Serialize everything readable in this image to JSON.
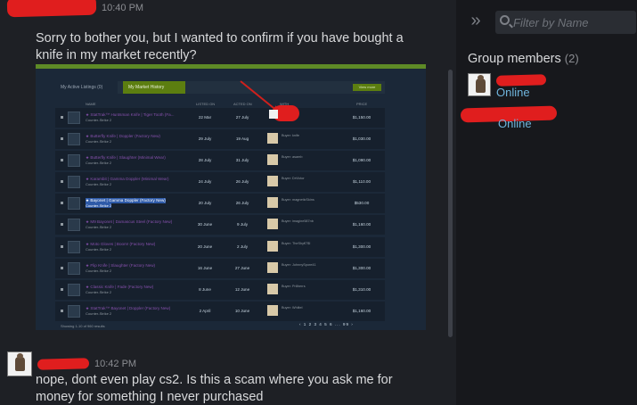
{
  "messages": [
    {
      "time": "10:40 PM",
      "text_lines": [
        "Sorry to bother you, but I wanted to confirm if you have bought a",
        "knife in my market recently?"
      ]
    },
    {
      "time": "10:42 PM",
      "text_lines": [
        "nope, dont even play cs2. Is this a scam where you ask me for",
        "money for something I never purchased"
      ]
    }
  ],
  "screenshot": {
    "tabs": [
      "My Active Listings (0)",
      "My Market History"
    ],
    "columns": [
      "NAME",
      "LISTED ON",
      "ACTED ON",
      "WITH",
      "PRICE"
    ],
    "rows": [
      {
        "name": "★ StatTrak™ Huntsman Knife | Tiger Tooth (Fa...",
        "game": "Counter-Strike 2",
        "listed": "22 Mar",
        "acted": "27 July",
        "buyer": "",
        "price": "$1,150.00"
      },
      {
        "name": "★ Butterfly Knife | Doppler (Factory New)",
        "game": "Counter-Strike 2",
        "listed": "29 July",
        "acted": "19 Aug",
        "buyer": "Buyer: knife",
        "price": "$1,030.00"
      },
      {
        "name": "★ Butterfly Knife | Slaughter (Minimal Wear)",
        "game": "Counter-Strike 2",
        "listed": "28 July",
        "acted": "31 July",
        "buyer": "Buyer: asamb",
        "price": "$1,090.00"
      },
      {
        "name": "★ Karambit | Gamma Doppler (Minimal Wear)",
        "game": "Counter-Strike 2",
        "listed": "24 July",
        "acted": "26 July",
        "buyer": "Buyer: DrVictor",
        "price": "$1,110.00"
      },
      {
        "name": "★ Bayonet | Gamma Doppler (Factory New)",
        "game": "Counter-Strike 2",
        "listed": "20 July",
        "acted": "26 July",
        "buyer": "Buyer: magneticSkins",
        "price": "$530.00"
      },
      {
        "name": "★ M9 Bayonet | Damascus Steel (Factory New)",
        "game": "Counter-Strike 2",
        "listed": "30 June",
        "acted": "9 July",
        "buyer": "Buyer: imagine587nb",
        "price": "$1,160.00"
      },
      {
        "name": "★ Moto Gloves | Boom! (Factory New)",
        "game": "Counter-Strike 2",
        "listed": "20 June",
        "acted": "2 July",
        "buyer": "Buyer: TheShy€7$!",
        "price": "$1,300.00"
      },
      {
        "name": "★ Flip Knife | Slaughter (Factory New)",
        "game": "Counter-Strike 2",
        "listed": "16 June",
        "acted": "27 June",
        "buyer": "Buyer: JohnnySpore41",
        "price": "$1,300.00"
      },
      {
        "name": "★ Classic Knife | Fade (Factory New)",
        "game": "Counter-Strike 2",
        "listed": "8 June",
        "acted": "12 June",
        "buyer": "Buyer: Pr8herrs",
        "price": "$1,310.00"
      },
      {
        "name": "★ StatTrak™ Bayonet | Doppler (Factory New)",
        "game": "Counter-Strike 2",
        "listed": "2 April",
        "acted": "10 June",
        "buyer": "Buyer: Whiitel",
        "price": "$1,160.00"
      }
    ],
    "footer": "Showing 1-10 of 960 results",
    "pagination": "‹ 1 2 3 4 5 6 ... 99 ›",
    "button": "View more"
  },
  "sidebar": {
    "filter_placeholder": "Filter by Name",
    "group_title": "Group members",
    "member_count": "(2)",
    "members": [
      {
        "status": "Online"
      },
      {
        "status": "Online"
      }
    ]
  },
  "colors": {
    "background": "#1e2025",
    "sidebar": "#17181c",
    "online": "#6fb4dc",
    "redaction": "#e01e1e"
  }
}
